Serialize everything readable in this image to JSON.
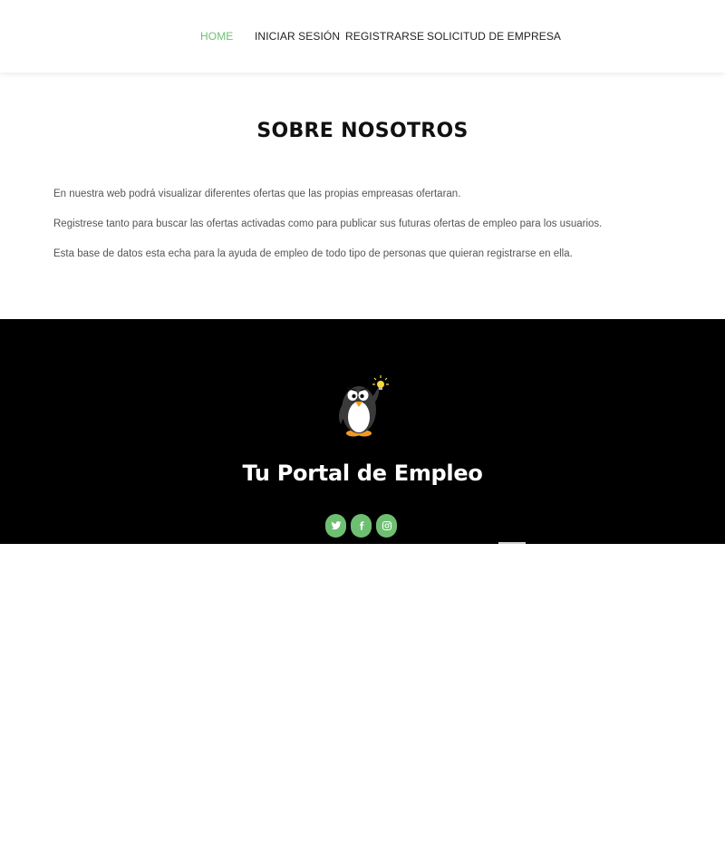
{
  "nav": {
    "items": [
      {
        "label": "HOME",
        "active": true
      },
      {
        "label": "INICIAR SESIÓN",
        "active": false
      },
      {
        "label": "REGISTRARSE",
        "active": false
      },
      {
        "label": "SOLICITUD DE EMPRESA",
        "active": false
      }
    ]
  },
  "about": {
    "title": "SOBRE NOSOTROS",
    "paragraphs": [
      "En nuestra web podrá visualizar diferentes ofertas que las propias empreasas ofertaran.",
      "Registrese tanto para buscar las ofertas activadas como para publicar sus futuras ofertas de empleo para los usuarios.",
      "Esta base de datos esta echa para la ayuda de empleo de todo tipo de personas que quieran registrarse en ella."
    ]
  },
  "footer": {
    "brand": "Tu Portal de Empleo",
    "logo_icon": "penguin-lightbulb-icon",
    "social": [
      "twitter-icon",
      "facebook-icon",
      "instagram-icon"
    ]
  },
  "colors": {
    "accent": "#6fbf73",
    "footer_bg": "#000000",
    "text": "#555555",
    "heading": "#111111"
  }
}
